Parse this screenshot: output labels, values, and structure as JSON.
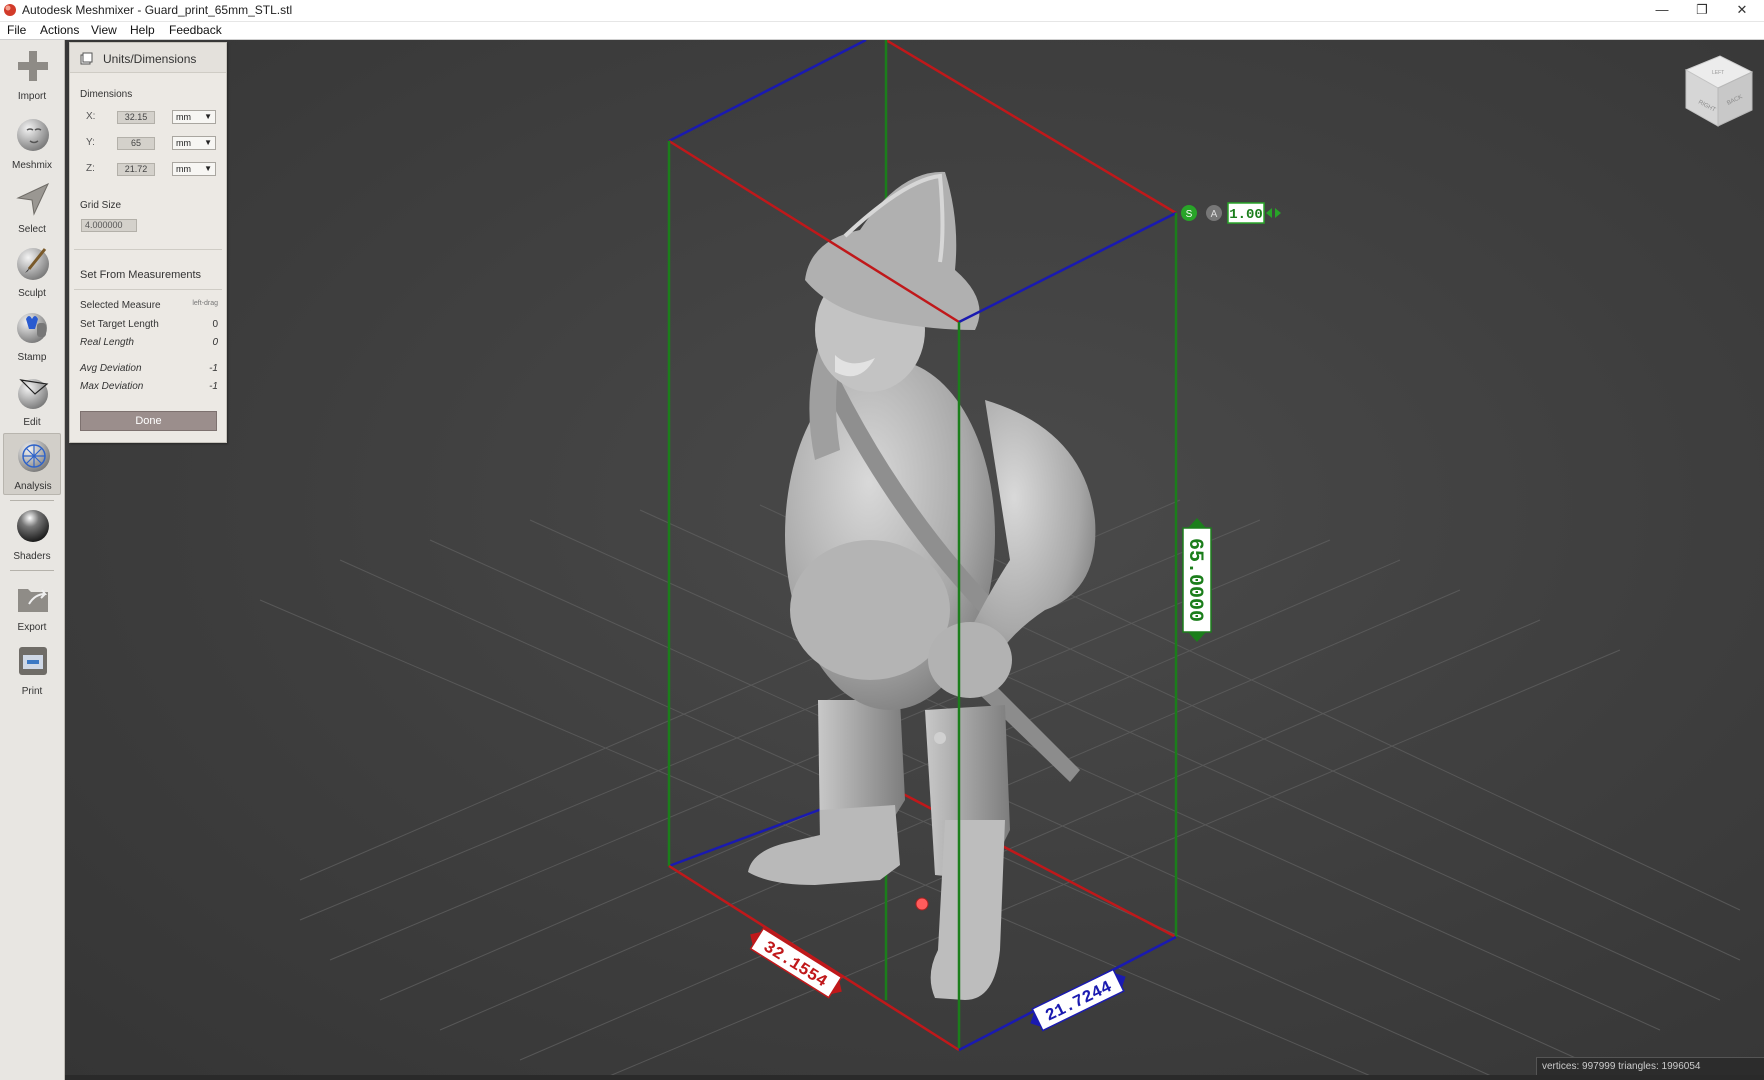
{
  "window": {
    "title": "Autodesk Meshmixer - Guard_print_65mm_STL.stl",
    "controls": {
      "minimize": "—",
      "restore": "❐",
      "close": "✕"
    }
  },
  "menu": [
    "File",
    "Actions",
    "View",
    "Help",
    "Feedback"
  ],
  "toolbar": {
    "tools": [
      {
        "label": "Import",
        "icon": "plus-icon"
      },
      {
        "label": "Meshmix",
        "icon": "meshmix-icon"
      },
      {
        "label": "Select",
        "icon": "select-arrow-icon"
      },
      {
        "label": "Sculpt",
        "icon": "sculpt-brush-icon"
      },
      {
        "label": "Stamp",
        "icon": "stamp-icon"
      },
      {
        "label": "Edit",
        "icon": "edit-icon"
      },
      {
        "label": "Analysis",
        "icon": "analysis-icon",
        "active": true
      },
      {
        "label": "Shaders",
        "icon": "shaders-icon"
      },
      {
        "label": "Export",
        "icon": "export-icon"
      },
      {
        "label": "Print",
        "icon": "print-icon"
      }
    ]
  },
  "panel": {
    "title": "Units/Dimensions",
    "dimensions_label": "Dimensions",
    "axes": [
      {
        "axis": "X:",
        "value": "32.15",
        "unit": "mm"
      },
      {
        "axis": "Y:",
        "value": "65",
        "unit": "mm"
      },
      {
        "axis": "Z:",
        "value": "21.72",
        "unit": "mm"
      }
    ],
    "grid_size_label": "Grid Size",
    "grid_size_value": "4.000000",
    "set_from_measurements": "Set From Measurements",
    "selected_measure_label": "Selected Measure",
    "selected_measure_hint": "left-drag",
    "set_target_length_label": "Set Target Length",
    "set_target_length_value": "0",
    "real_length_label": "Real Length",
    "real_length_value": "0",
    "avg_deviation_label": "Avg Deviation",
    "avg_deviation_value": "-1",
    "max_deviation_label": "Max Deviation",
    "max_deviation_value": "-1",
    "done_label": "Done"
  },
  "viewport": {
    "scale_handle": {
      "s_label": "S",
      "a_label": "A",
      "value": "1.00"
    },
    "dimension_labels": {
      "x": "32.1554",
      "y": "65.0000",
      "z": "21.7244"
    },
    "view_cube_labels": {
      "left": "LEFT",
      "right": "RIGHT",
      "back": "BACK"
    },
    "colors": {
      "x_axis": "#c0181a",
      "y_axis": "#1b7e1b",
      "z_axis": "#1a1ab0",
      "background": "#3e3e3e"
    }
  },
  "status_bar": "vertices: 997999 triangles: 1996054"
}
